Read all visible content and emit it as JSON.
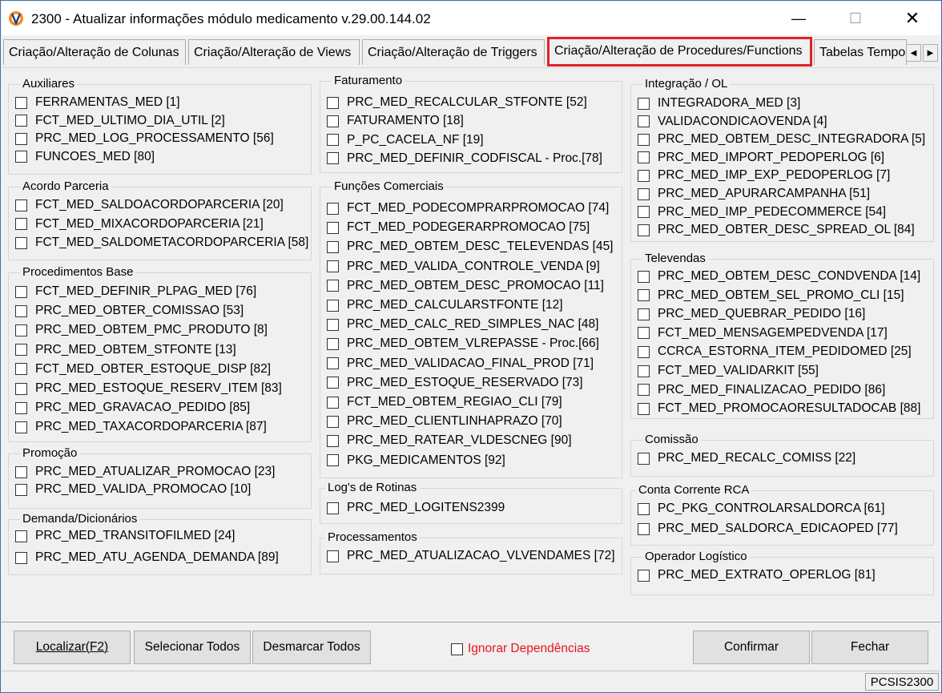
{
  "window": {
    "title": "2300 - Atualizar informações módulo medicamento v.29.00.144.02",
    "minimize": "—",
    "maximize": "☐",
    "close": "✕"
  },
  "tabs": [
    "Criação/Alteração de Colunas",
    "Criação/Alteração de Views",
    "Criação/Alteração de Triggers",
    "Criação/Alteração de Procedures/Functions",
    "Tabelas Tempo"
  ],
  "tab_arrows": {
    "left": "◀",
    "right": "▶"
  },
  "groups": {
    "auxiliares": {
      "title": "Auxiliares",
      "items": [
        "FERRAMENTAS_MED [1]",
        "FCT_MED_ULTIMO_DIA_UTIL [2]",
        "PRC_MED_LOG_PROCESSAMENTO [56]",
        "FUNCOES_MED [80]"
      ]
    },
    "acordo": {
      "title": "Acordo Parceria",
      "items": [
        "FCT_MED_SALDOACORDOPARCERIA [20]",
        "FCT_MED_MIXACORDOPARCERIA [21]",
        "FCT_MED_SALDOMETACORDOPARCERIA [58]"
      ]
    },
    "procbase": {
      "title": "Procedimentos Base",
      "items": [
        "FCT_MED_DEFINIR_PLPAG_MED [76]",
        "PRC_MED_OBTER_COMISSAO [53]",
        "PRC_MED_OBTEM_PMC_PRODUTO [8]",
        "PRC_MED_OBTEM_STFONTE [13]",
        "FCT_MED_OBTER_ESTOQUE_DISP [82]",
        "PRC_MED_ESTOQUE_RESERV_ITEM [83]",
        "PRC_MED_GRAVACAO_PEDIDO [85]",
        "PRC_MED_TAXACORDOPARCERIA [87]"
      ]
    },
    "promocao": {
      "title": "Promoção",
      "items": [
        "PRC_MED_ATUALIZAR_PROMOCAO [23]",
        "PRC_MED_VALIDA_PROMOCAO [10]"
      ]
    },
    "demanda": {
      "title": "Demanda/Dicionários",
      "items": [
        "PRC_MED_TRANSITOFILMED [24]",
        "PRC_MED_ATU_AGENDA_DEMANDA [89]"
      ]
    },
    "faturamento": {
      "title": "Faturamento",
      "items": [
        "PRC_MED_RECALCULAR_STFONTE [52]",
        "FATURAMENTO [18]",
        "P_PC_CACELA_NF [19]",
        "PRC_MED_DEFINIR_CODFISCAL - Proc.[78]"
      ]
    },
    "comerciais": {
      "title": "Funções Comerciais",
      "items": [
        "FCT_MED_PODECOMPRARPROMOCAO [74]",
        "FCT_MED_PODEGERARPROMOCAO [75]",
        "PRC_MED_OBTEM_DESC_TELEVENDAS [45]",
        "PRC_MED_VALIDA_CONTROLE_VENDA [9]",
        "PRC_MED_OBTEM_DESC_PROMOCAO [11]",
        "PRC_MED_CALCULARSTFONTE [12]",
        "PRC_MED_CALC_RED_SIMPLES_NAC [48]",
        "PRC_MED_OBTEM_VLREPASSE - Proc.[66]",
        "PRC_MED_VALIDACAO_FINAL_PROD [71]",
        "PRC_MED_ESTOQUE_RESERVADO [73]",
        "FCT_MED_OBTEM_REGIAO_CLI [79]",
        "PRC_MED_CLIENTLINHAPRAZO [70]",
        "PRC_MED_RATEAR_VLDESCNEG [90]",
        "PKG_MEDICAMENTOS [92]"
      ]
    },
    "logs": {
      "title": "Log's de Rotinas",
      "items": [
        "PRC_MED_LOGITENS2399"
      ]
    },
    "processamentos": {
      "title": "Processamentos",
      "items": [
        "PRC_MED_ATUALIZACAO_VLVENDAMES [72]"
      ]
    },
    "integracao": {
      "title": "Integração / OL",
      "items": [
        "INTEGRADORA_MED [3]",
        "VALIDACONDICAOVENDA [4]",
        "PRC_MED_OBTEM_DESC_INTEGRADORA [5]",
        "PRC_MED_IMPORT_PEDOPERLOG [6]",
        "PRC_MED_IMP_EXP_PEDOPERLOG [7]",
        "PRC_MED_APURARCAMPANHA [51]",
        "PRC_MED_IMP_PEDECOMMERCE [54]",
        "PRC_MED_OBTER_DESC_SPREAD_OL [84]"
      ]
    },
    "televendas": {
      "title": "Televendas",
      "items": [
        "PRC_MED_OBTEM_DESC_CONDVENDA [14]",
        "PRC_MED_OBTEM_SEL_PROMO_CLI [15]",
        "PRC_MED_QUEBRAR_PEDIDO [16]",
        "FCT_MED_MENSAGEMPEDVENDA [17]",
        "CCRCA_ESTORNA_ITEM_PEDIDOMED [25]",
        "FCT_MED_VALIDARKIT [55]",
        "PRC_MED_FINALIZACAO_PEDIDO [86]",
        "FCT_MED_PROMOCAORESULTADOCAB [88]"
      ]
    },
    "comissao": {
      "title": "Comissão",
      "items": [
        "PRC_MED_RECALC_COMISS [22]"
      ]
    },
    "contacorrente": {
      "title": "Conta Corrente RCA",
      "items": [
        "PC_PKG_CONTROLARSALDORCA [61]",
        "PRC_MED_SALDORCA_EDICAOPED [77]"
      ]
    },
    "operador": {
      "title": "Operador Logístico",
      "items": [
        "PRC_MED_EXTRATO_OPERLOG [81]"
      ]
    }
  },
  "buttons": {
    "localizar": "Localizar(F2)",
    "selecionar": "Selecionar Todos",
    "desmarcar": "Desmarcar Todos",
    "confirmar": "Confirmar",
    "fechar": "Fechar"
  },
  "ignorar": "Ignorar Dependências",
  "status": "PCSIS2300"
}
